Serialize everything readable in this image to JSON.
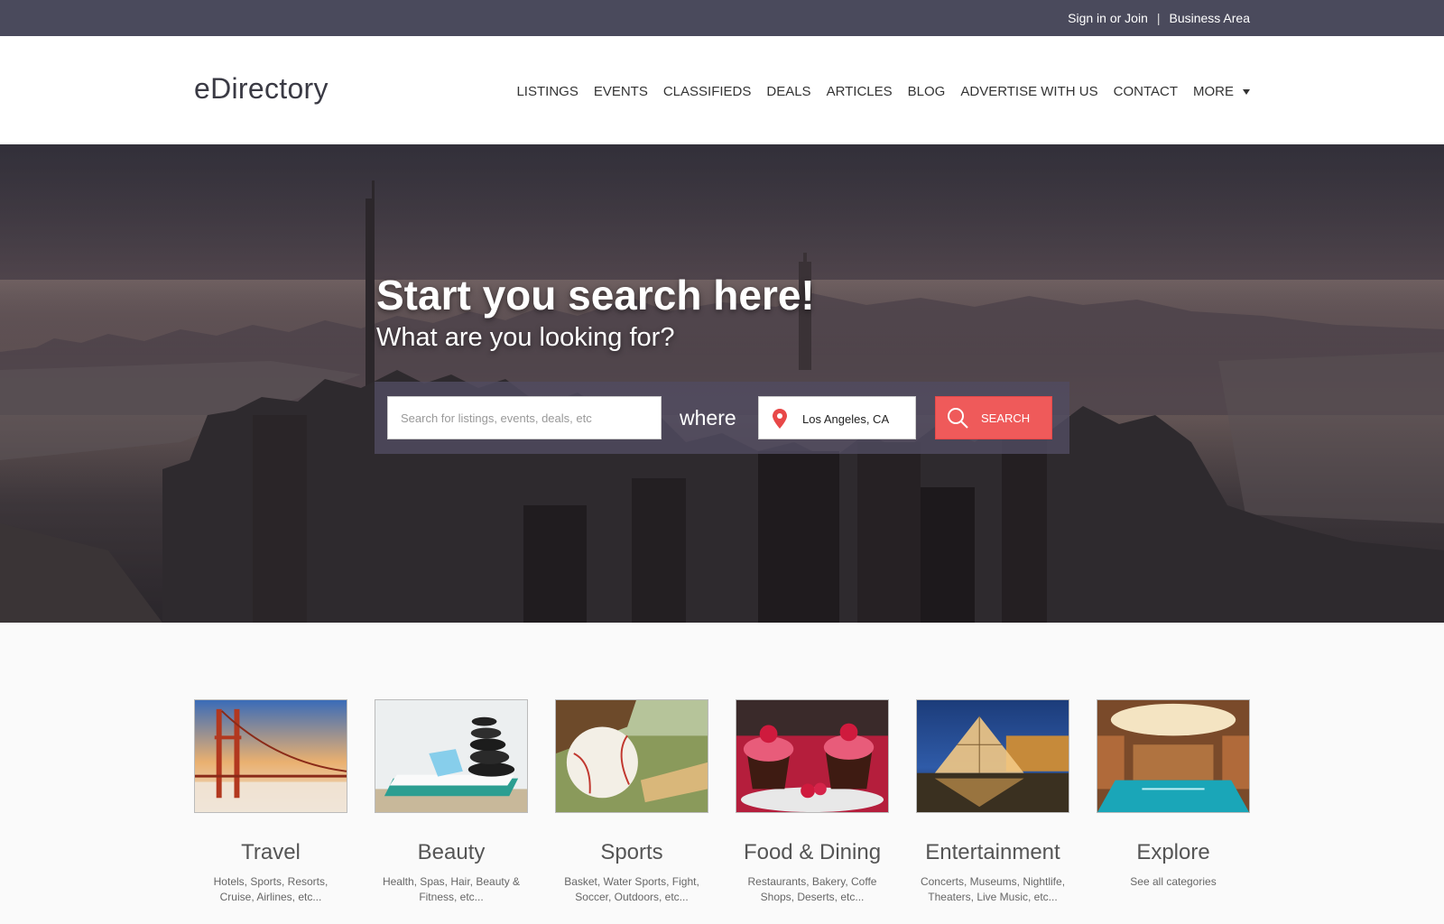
{
  "topbar": {
    "signin_label": "Sign in or Join",
    "separator": "|",
    "business_label": "Business Area"
  },
  "header": {
    "logo": "eDirectory",
    "nav": [
      "LISTINGS",
      "EVENTS",
      "CLASSIFIEDS",
      "DEALS",
      "ARTICLES",
      "BLOG",
      "ADVERTISE WITH US",
      "CONTACT",
      "MORE"
    ]
  },
  "hero": {
    "title": "Start you search here!",
    "subtitle": "What are you looking for?",
    "search_placeholder": "Search for listings, events, deals, etc",
    "where_label": "where",
    "location_value": "Los Angeles, CA",
    "search_button": "SEARCH"
  },
  "categories": [
    {
      "name": "Travel",
      "desc": "Hotels, Sports, Resorts, Cruise, Airlines, etc..."
    },
    {
      "name": "Beauty",
      "desc": "Health, Spas, Hair, Beauty & Fitness, etc..."
    },
    {
      "name": "Sports",
      "desc": "Basket, Water Sports, Fight, Soccer, Outdoors, etc..."
    },
    {
      "name": "Food & Dining",
      "desc": "Restaurants, Bakery, Coffe Shops, Deserts, etc..."
    },
    {
      "name": "Entertainment",
      "desc": "Concerts, Museums, Nightlife, Theaters, Live Music, etc..."
    },
    {
      "name": "Explore",
      "desc": "See all categories"
    }
  ],
  "colors": {
    "topbar": "#4a4a5c",
    "search_button": "#ef5a5a",
    "pin": "#e84848"
  }
}
